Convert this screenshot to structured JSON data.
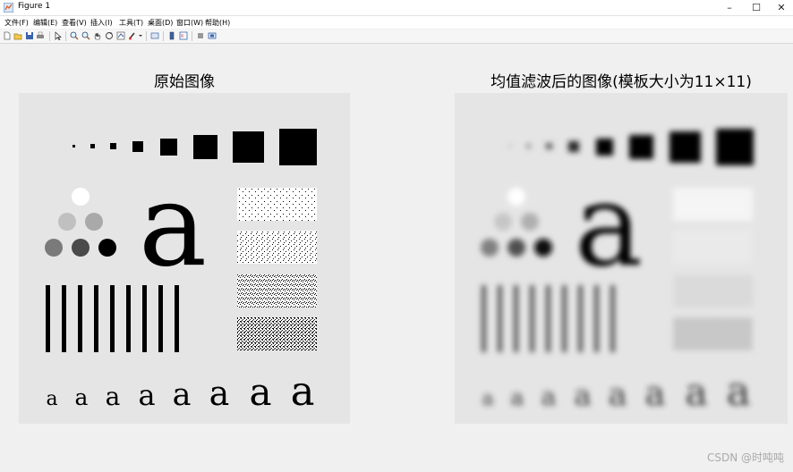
{
  "window": {
    "title": "Figure 1"
  },
  "menu": [
    "文件(F)",
    "编辑(E)",
    "查看(V)",
    "插入(I)",
    "工具(T)",
    "桌面(D)",
    "窗口(W)",
    "帮助(H)"
  ],
  "toolbar": [
    "new-file-icon",
    "open-file-icon",
    "save-icon",
    "print-icon",
    "select-arrow-icon",
    "zoom-in-icon",
    "zoom-out-icon",
    "pan-hand-icon",
    "rotate-3d-icon",
    "data-cursor-icon",
    "brush-icon",
    "link-plot-icon",
    "insert-colorbar-icon",
    "insert-legend-icon",
    "hide-plot-tools-icon",
    "show-plot-tools-icon"
  ],
  "axes": [
    {
      "title": "原始图像"
    },
    {
      "title": "均值滤波后的图像(模板大小为11×11)"
    }
  ],
  "watermark": "CSDN @时吨吨"
}
